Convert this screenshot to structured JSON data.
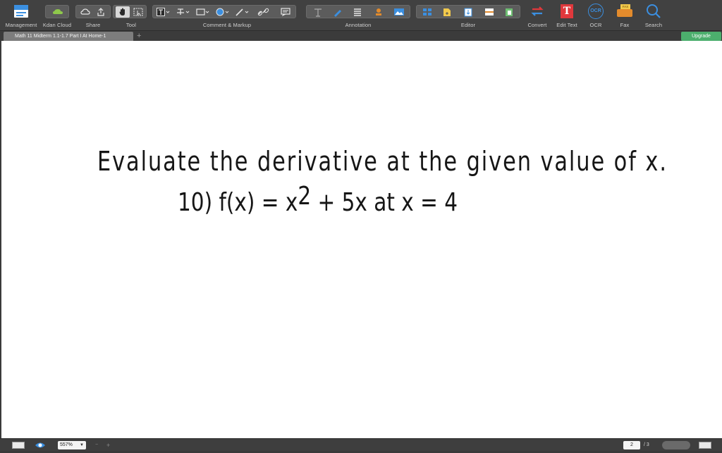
{
  "toolbar": {
    "management_label": "Management",
    "kdan_cloud_label": "Kdan Cloud",
    "share_label": "Share",
    "tool_label": "Tool",
    "comment_markup_label": "Comment & Markup",
    "annotation_label": "Annotation",
    "editor_label": "Editor",
    "convert_label": "Convert",
    "edit_text_label": "Edit Text",
    "ocr_label": "OCR",
    "fax_label": "Fax",
    "search_label": "Search",
    "ocr_icon_text": "OCR",
    "fax_icon_text": "FAX",
    "edit_text_icon_text": "T"
  },
  "tabs": {
    "doc_title": "Math 11 Midterm 1.1-1.7 Part I At Home-1",
    "add_symbol": "+",
    "upgrade_label": "Upgrade"
  },
  "document": {
    "heading": "Evaluate the derivative at the given value of x.",
    "problem_prefix": "10) f(x) = x",
    "problem_exponent": "2",
    "problem_suffix": " + 5x at x = 4"
  },
  "status": {
    "zoom": "557%",
    "current_page": "2",
    "total_pages": "/ 3",
    "minus": "−",
    "plus": "+"
  },
  "colors": {
    "toolbar_bg": "#414141",
    "upgrade_bg": "#4caf6d",
    "accent_blue": "#3b8fe0",
    "accent_red": "#e0383c",
    "document_bg": "#ffffff"
  }
}
